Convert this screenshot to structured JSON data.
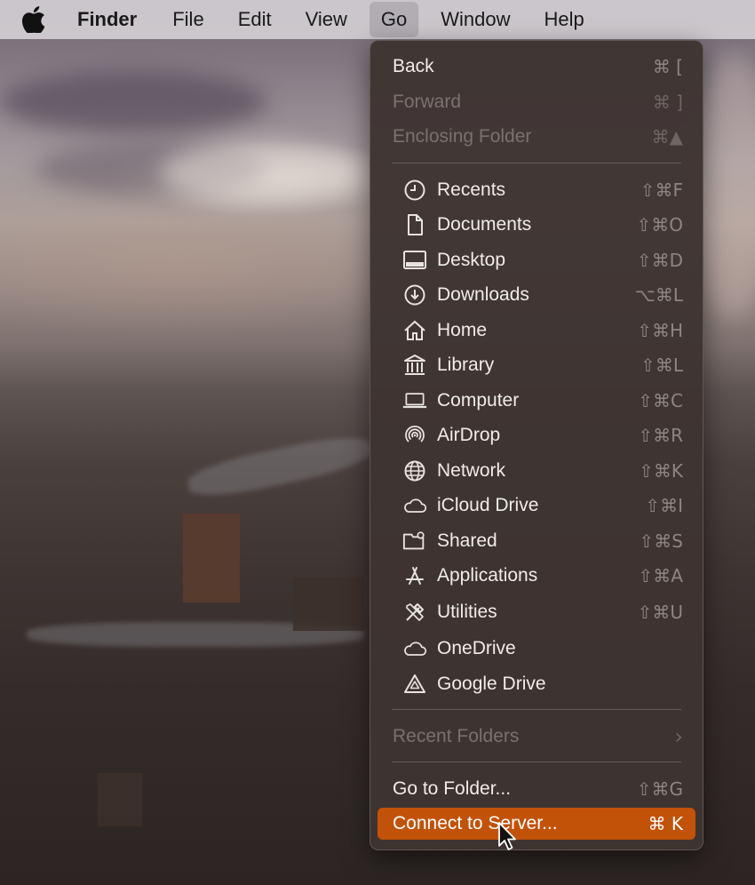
{
  "menubar": {
    "items": [
      {
        "label": "Finder"
      },
      {
        "label": "File"
      },
      {
        "label": "Edit"
      },
      {
        "label": "View"
      },
      {
        "label": "Go"
      },
      {
        "label": "Window"
      },
      {
        "label": "Help"
      }
    ]
  },
  "go_menu": {
    "history": [
      {
        "label": "Back",
        "shortcut": "⌘ [",
        "enabled": true
      },
      {
        "label": "Forward",
        "shortcut": "⌘ ]",
        "enabled": false
      },
      {
        "label": "Enclosing Folder",
        "shortcut": "⌘▲",
        "enabled": false
      }
    ],
    "places": [
      {
        "label": "Recents",
        "shortcut": "⇧⌘F",
        "icon": "clock-icon"
      },
      {
        "label": "Documents",
        "shortcut": "⇧⌘O",
        "icon": "document-icon"
      },
      {
        "label": "Desktop",
        "shortcut": "⇧⌘D",
        "icon": "desktop-icon"
      },
      {
        "label": "Downloads",
        "shortcut": "⌥⌘L",
        "icon": "download-icon"
      },
      {
        "label": "Home",
        "shortcut": "⇧⌘H",
        "icon": "house-icon"
      },
      {
        "label": "Library",
        "shortcut": "⇧⌘L",
        "icon": "library-icon"
      },
      {
        "label": "Computer",
        "shortcut": "⇧⌘C",
        "icon": "laptop-icon"
      },
      {
        "label": "AirDrop",
        "shortcut": "⇧⌘R",
        "icon": "airdrop-icon"
      },
      {
        "label": "Network",
        "shortcut": "⇧⌘K",
        "icon": "globe-icon"
      },
      {
        "label": "iCloud Drive",
        "shortcut": "⇧⌘I",
        "icon": "cloud-icon"
      },
      {
        "label": "Shared",
        "shortcut": "⇧⌘S",
        "icon": "shared-folder-icon"
      },
      {
        "label": "Applications",
        "shortcut": "⇧⌘A",
        "icon": "applications-icon"
      },
      {
        "label": "Utilities",
        "shortcut": "⇧⌘U",
        "icon": "tools-icon"
      },
      {
        "label": "OneDrive",
        "shortcut": "",
        "icon": "cloud-icon"
      },
      {
        "label": "Google Drive",
        "shortcut": "",
        "icon": "google-drive-icon"
      }
    ],
    "recent_folders": {
      "label": "Recent Folders",
      "submenu_indicator": "›",
      "enabled": false
    },
    "go_to_folder": {
      "label": "Go to Folder...",
      "shortcut": "⇧⌘G"
    },
    "connect_to_server": {
      "label": "Connect to Server...",
      "shortcut": "⌘ K",
      "highlighted": true
    }
  },
  "colors": {
    "highlight": "#c35209",
    "menu_bg": "#3e3432",
    "menubar_bg": "#d2cdd2"
  }
}
